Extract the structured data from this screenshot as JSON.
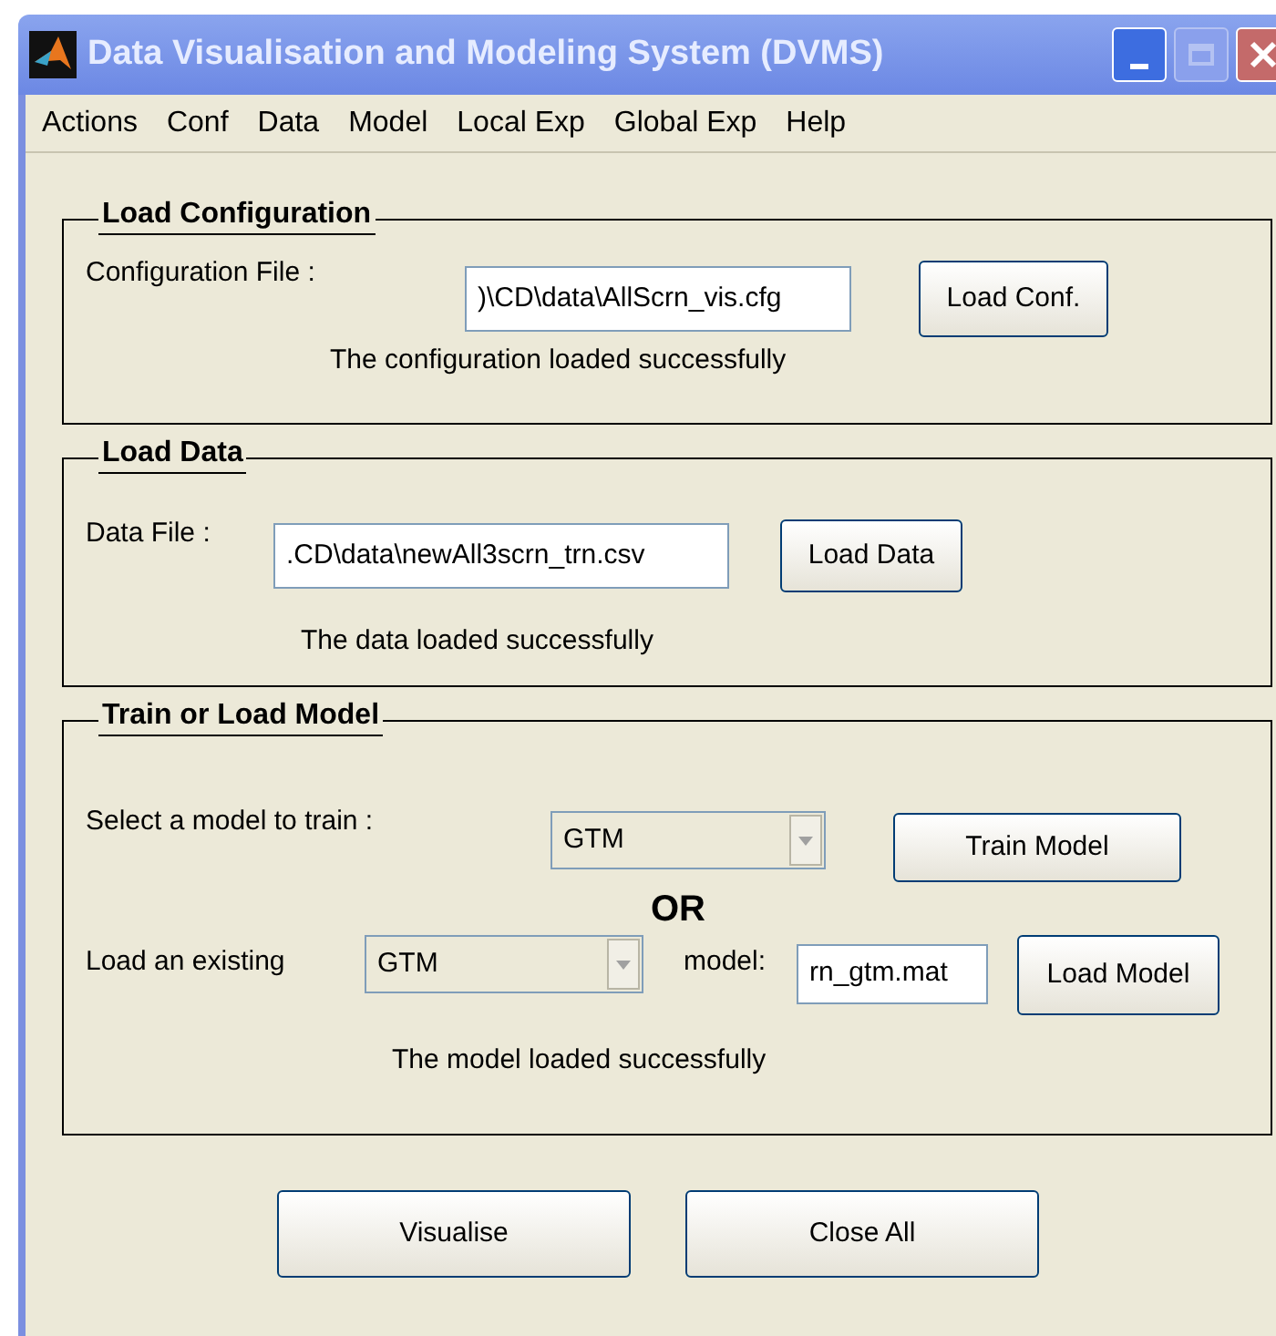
{
  "window": {
    "title": "Data Visualisation and Modeling System (DVMS)",
    "maximize_disabled": true
  },
  "menu": [
    "Actions",
    "Conf",
    "Data",
    "Model",
    "Local Exp",
    "Global Exp",
    "Help"
  ],
  "config_panel": {
    "title": "Load Configuration",
    "label": "Configuration File :",
    "value": ")\\CD\\data\\AllScrn_vis.cfg",
    "button": "Load Conf.",
    "message": "The configuration loaded successfully"
  },
  "data_panel": {
    "title": "Load Data",
    "label": "Data File :",
    "value": ".CD\\data\\newAll3scrn_trn.csv",
    "button": "Load Data",
    "message": "The data loaded successfully"
  },
  "model_panel": {
    "title": "Train or Load Model",
    "train_label": "Select a model to train :",
    "train_select": "GTM",
    "train_button": "Train Model",
    "or_text": "OR",
    "load_label": "Load an existing",
    "load_select": "GTM",
    "model_label": "model:",
    "model_value": "rn_gtm.mat",
    "load_button": "Load Model",
    "message": "The model loaded successfully"
  },
  "buttons": [
    "Visualise",
    "Close All"
  ]
}
